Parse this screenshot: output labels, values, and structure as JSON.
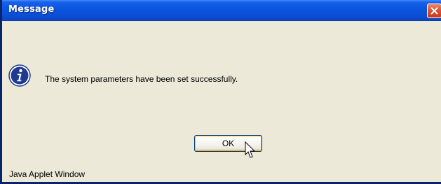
{
  "window": {
    "title": "Message",
    "message": "The system parameters have been set successfully.",
    "status": "Java Applet Window",
    "icons": {
      "info": "info-icon",
      "close": "close-icon",
      "cursor": "mouse-pointer-icon"
    },
    "colors": {
      "titlebar": "#0A4FD6",
      "body_bg": "#ECE9D8",
      "close_btn": "#D9502F",
      "info_icon": "#1F3A93"
    }
  },
  "buttons": {
    "ok_label": "OK"
  }
}
